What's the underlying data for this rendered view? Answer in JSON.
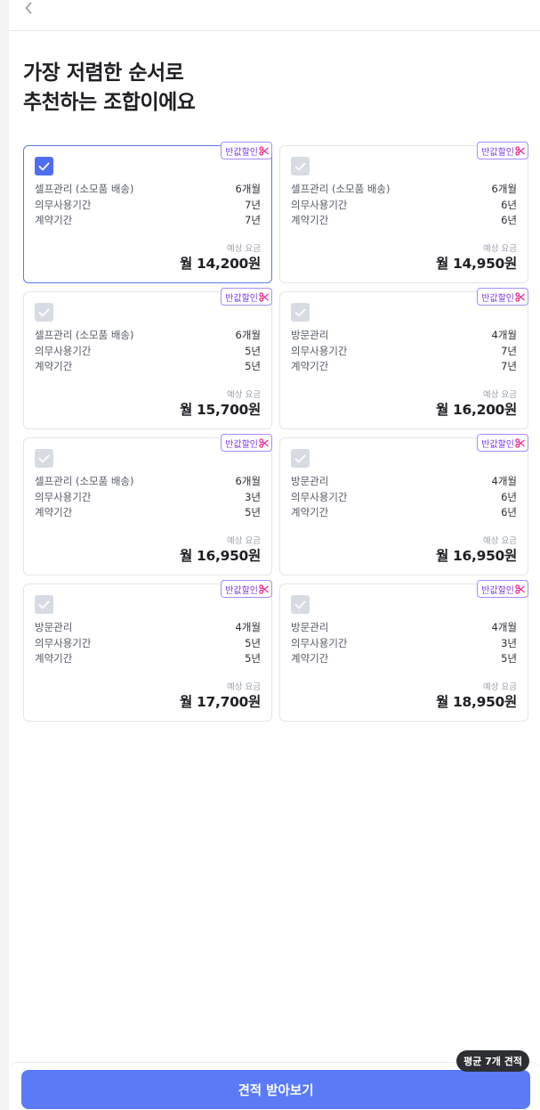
{
  "header": {
    "back_icon": "chevron-left-icon"
  },
  "title": {
    "line1": "가장 저렴한 순서로",
    "line2": "추천하는 조합이에요"
  },
  "discount_badge": "반값할인",
  "price_label": "예상 요금",
  "colors": {
    "accent": "#5a7af6",
    "selected_border": "#5c7be2",
    "badge": "#7c3aed"
  },
  "cards": [
    {
      "selected": true,
      "rows": [
        {
          "label": "셀프관리 (소모품 배송)",
          "value": "6개월"
        },
        {
          "label": "의무사용기간",
          "value": "7년"
        },
        {
          "label": "계약기간",
          "value": "7년"
        }
      ],
      "price": "월 14,200원"
    },
    {
      "selected": false,
      "rows": [
        {
          "label": "셀프관리 (소모품 배송)",
          "value": "6개월"
        },
        {
          "label": "의무사용기간",
          "value": "6년"
        },
        {
          "label": "계약기간",
          "value": "6년"
        }
      ],
      "price": "월 14,950원"
    },
    {
      "selected": false,
      "rows": [
        {
          "label": "셀프관리 (소모품 배송)",
          "value": "6개월"
        },
        {
          "label": "의무사용기간",
          "value": "5년"
        },
        {
          "label": "계약기간",
          "value": "5년"
        }
      ],
      "price": "월 15,700원"
    },
    {
      "selected": false,
      "rows": [
        {
          "label": "방문관리",
          "value": "4개월"
        },
        {
          "label": "의무사용기간",
          "value": "7년"
        },
        {
          "label": "계약기간",
          "value": "7년"
        }
      ],
      "price": "월 16,200원"
    },
    {
      "selected": false,
      "rows": [
        {
          "label": "셀프관리 (소모품 배송)",
          "value": "6개월"
        },
        {
          "label": "의무사용기간",
          "value": "3년"
        },
        {
          "label": "계약기간",
          "value": "5년"
        }
      ],
      "price": "월 16,950원"
    },
    {
      "selected": false,
      "rows": [
        {
          "label": "방문관리",
          "value": "4개월"
        },
        {
          "label": "의무사용기간",
          "value": "6년"
        },
        {
          "label": "계약기간",
          "value": "6년"
        }
      ],
      "price": "월 16,950원"
    },
    {
      "selected": false,
      "rows": [
        {
          "label": "방문관리",
          "value": "4개월"
        },
        {
          "label": "의무사용기간",
          "value": "5년"
        },
        {
          "label": "계약기간",
          "value": "5년"
        }
      ],
      "price": "월 17,700원"
    },
    {
      "selected": false,
      "rows": [
        {
          "label": "방문관리",
          "value": "4개월"
        },
        {
          "label": "의무사용기간",
          "value": "3년"
        },
        {
          "label": "계약기간",
          "value": "5년"
        }
      ],
      "price": "월 18,950원"
    }
  ],
  "footer": {
    "cta_label": "견적 받아보기",
    "avg_badge": "평균 7개 견적"
  }
}
